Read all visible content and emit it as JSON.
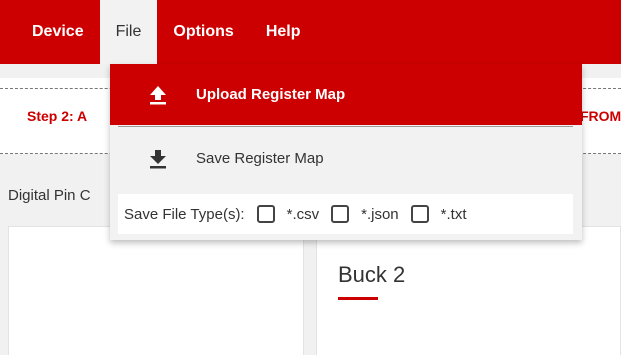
{
  "menubar": {
    "items": [
      {
        "label": "Device"
      },
      {
        "label": "File"
      },
      {
        "label": "Options"
      },
      {
        "label": "Help"
      }
    ],
    "active": "File",
    "color": "#cc0000"
  },
  "background": {
    "step_label_left": "Step 2: A",
    "step_label_right": "FROM",
    "digital_pin_label": "Digital Pin C",
    "panel_right_title": "Buck 2"
  },
  "file_menu": {
    "upload": {
      "label": "Upload Register Map",
      "icon": "upload-icon"
    },
    "save": {
      "label": "Save Register Map",
      "icon": "download-icon"
    },
    "file_types": {
      "label": "Save File Type(s):",
      "options": [
        {
          "label": "*.csv",
          "checked": false
        },
        {
          "label": "*.json",
          "checked": false
        },
        {
          "label": "*.txt",
          "checked": false
        }
      ]
    }
  }
}
